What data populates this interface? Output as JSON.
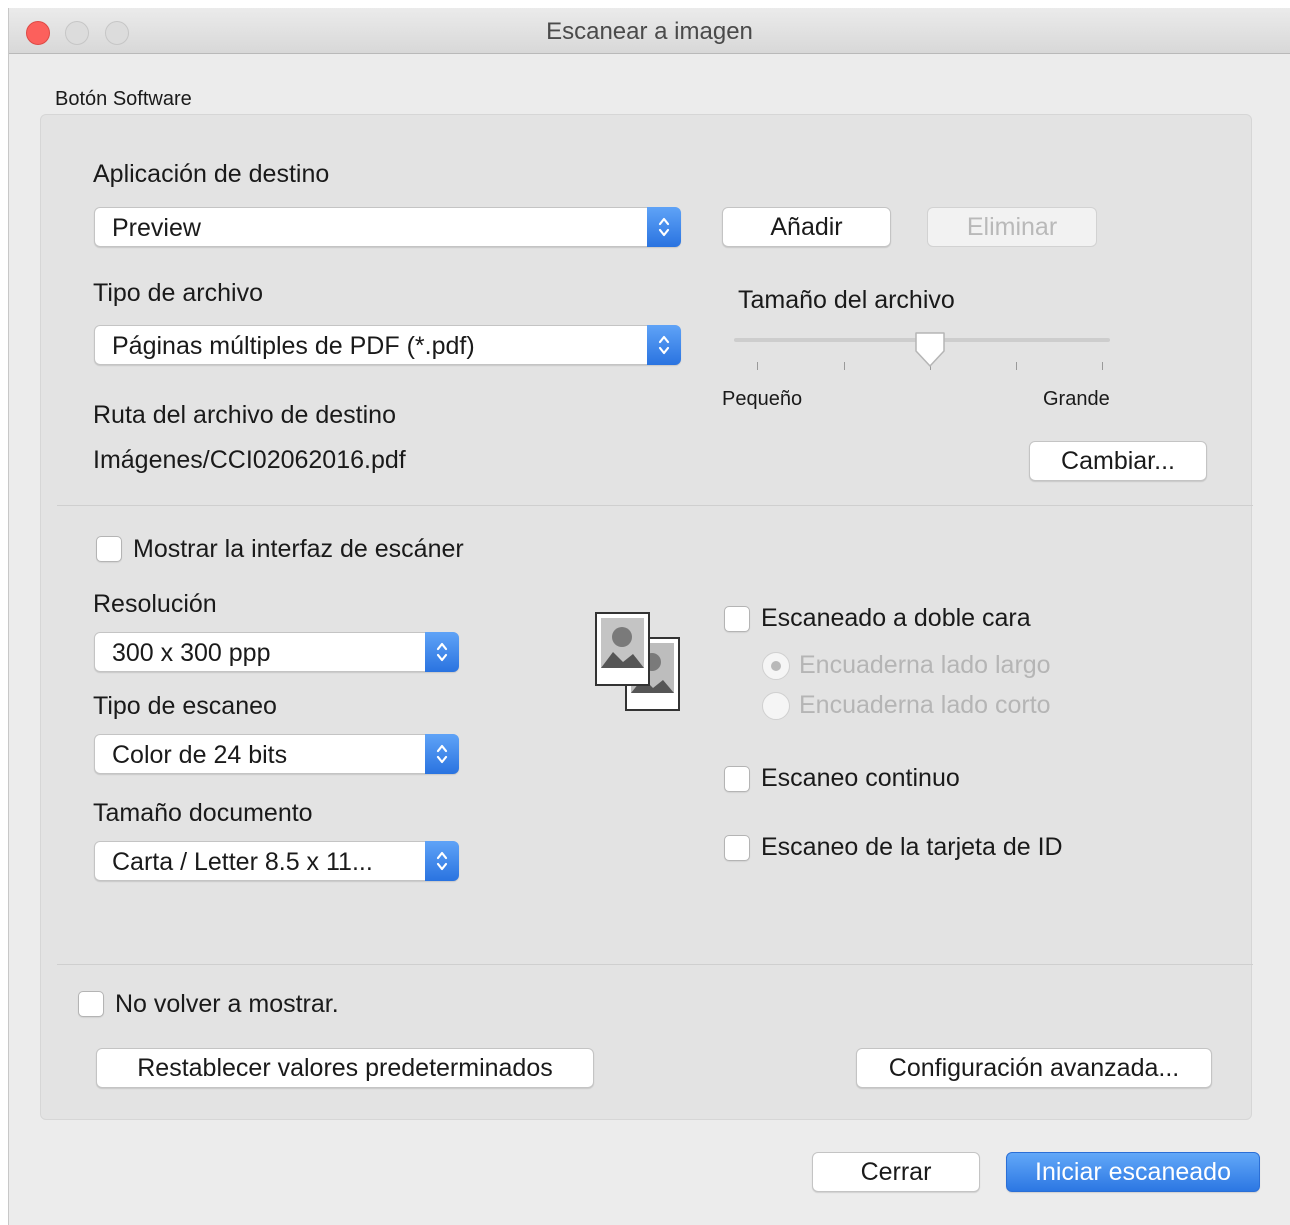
{
  "window": {
    "title": "Escanear a imagen"
  },
  "group_label": "Botón Software",
  "target_app": {
    "label": "Aplicación de destino",
    "value": "Preview",
    "add_label": "Añadir",
    "remove_label": "Eliminar"
  },
  "file_type": {
    "label": "Tipo de archivo",
    "value": "Páginas múltiples de PDF (*.pdf)"
  },
  "file_size": {
    "label": "Tamaño del archivo",
    "min_label": "Pequeño",
    "max_label": "Grande",
    "level": 0.5
  },
  "dest_path": {
    "label": "Ruta del archivo de destino",
    "value": "Imágenes/CCI02062016.pdf",
    "change_label": "Cambiar..."
  },
  "show_scanner_ui": {
    "label": "Mostrar la interfaz de escáner",
    "checked": false
  },
  "resolution": {
    "label": "Resolución",
    "value": "300 x 300 ppp"
  },
  "scan_type": {
    "label": "Tipo de escaneo",
    "value": "Color de 24 bits"
  },
  "doc_size": {
    "label": "Tamaño documento",
    "value": "Carta / Letter 8.5 x 11..."
  },
  "duplex": {
    "label": "Escaneado a doble cara",
    "checked": false,
    "long_edge_label": "Encuaderna lado largo",
    "short_edge_label": "Encuaderna lado corto",
    "selected": "long_edge"
  },
  "continuous_scan": {
    "label": "Escaneo continuo",
    "checked": false
  },
  "id_card_scan": {
    "label": "Escaneo de la tarjeta de ID",
    "checked": false
  },
  "dont_show_again": {
    "label": "No volver a mostrar.",
    "checked": false
  },
  "buttons": {
    "reset_defaults": "Restablecer valores predeterminados",
    "advanced_settings": "Configuración avanzada...",
    "close": "Cerrar",
    "start_scan": "Iniciar escaneado"
  },
  "colors": {
    "accent": "#2c77e3",
    "close_light": "#fc605c"
  }
}
